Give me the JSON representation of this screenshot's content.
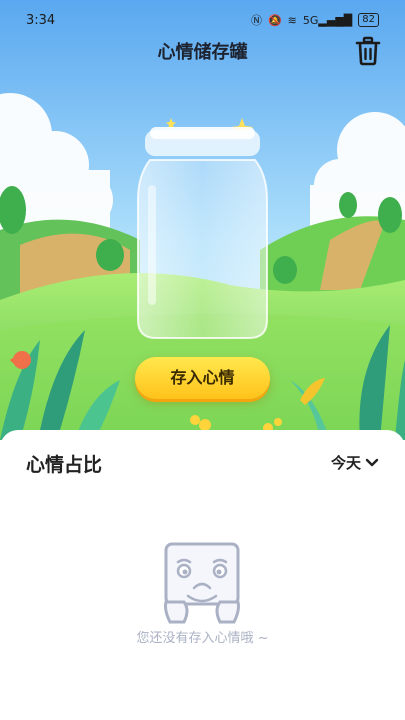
{
  "status_bar": {
    "time": "3:34",
    "signal_label": "5G",
    "battery": "82"
  },
  "header": {
    "title": "心情储存罐",
    "trash_icon": "trash-icon"
  },
  "jar_scene": {
    "save_button_label": "存入心情"
  },
  "mood_share": {
    "title": "心情占比",
    "period": "今天",
    "empty_text": "您还没有存入心情哦 ~"
  },
  "colors": {
    "sky_top": "#5aa8f0",
    "grass": "#7ed957",
    "button": "#ffd42a",
    "muted_text": "#aab1c4"
  }
}
